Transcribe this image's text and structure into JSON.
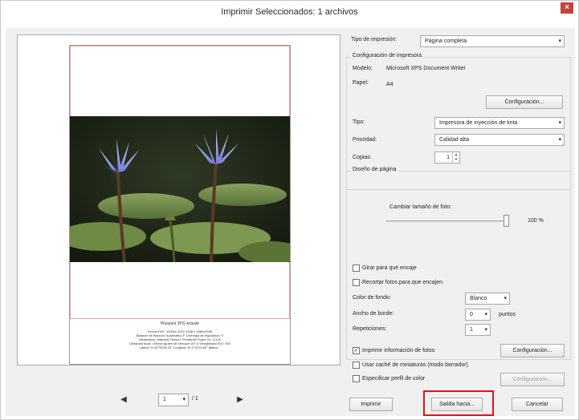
{
  "window": {
    "title": "Imprimir  Seleccionados: 1 archivos",
    "close_glyph": "×"
  },
  "preview": {
    "caption_name": "Pluspunt JPG  wrauwr",
    "caption_lines": [
      "Fecha EXIF: 10/Dec 2010  2008:1 4960x3936",
      "Balance de blancos: Automatico  F 4/Ventaja de exposicion: 0",
      "Mediciones: Matricial  Tiempo: Pendiente  Flash: no, 1/125",
      "Distancia focal: 100mm  Ajuste de enfoque: AF-S  Sensibilidad ISO: 400",
      "Latitud: N 40°30'59.32\"  Longitud: W 4°10'29.62\"  Altitud: -"
    ]
  },
  "pager": {
    "prev": "◀",
    "next": "▶",
    "current_page": "1",
    "separator": "/",
    "total_pages": "1",
    "caret": "▾"
  },
  "settings": {
    "print_type_label": "Tipo de impresión:",
    "print_type_value": "Página completa",
    "printer_group_title": "Configuración de impresora",
    "model_label": "Modelo:",
    "model_value": "Microsoft XPS Document Writer",
    "paper_label": "Papel:",
    "paper_value": "A4",
    "config_button": "Configuración...",
    "type_label": "Tipo:",
    "type_value": "Impresora de inyección de tinta",
    "priority_label": "Prioridad:",
    "priority_value": "Calidad alta",
    "copies_label": "Copias:",
    "copies_value": "1",
    "layout_group_title": "Diseño de página",
    "resize_label": "Cambiar tamaño de foto:",
    "resize_value": 100,
    "resize_text": "100 %",
    "rotate_label": "Girar para que encaje",
    "crop_label": "Recortar fotos para que encajen",
    "bg_color_label": "Color de fondo:",
    "bg_color_value": "Blanco",
    "border_label": "Ancho de borde:",
    "border_value": "0",
    "border_unit": "puntos",
    "repeat_label": "Repeticiones:",
    "repeat_value": "1",
    "print_info_label": "Imprimir información de fotos",
    "print_info_checked": true,
    "print_info_config": "Configuración...",
    "thumb_cache_label": "Usar caché de miniaturas (modo borrador)",
    "color_profile_label": "Especificar perfil de color",
    "color_profile_config": "Configuración..."
  },
  "footer": {
    "print_button": "Imprimir",
    "output_button": "Salida hacia...",
    "cancel_button": "Cancelar"
  },
  "colors": {
    "highlight": "#e0141a",
    "close": "#c7413b",
    "page_margin": "#f1a1a1"
  }
}
